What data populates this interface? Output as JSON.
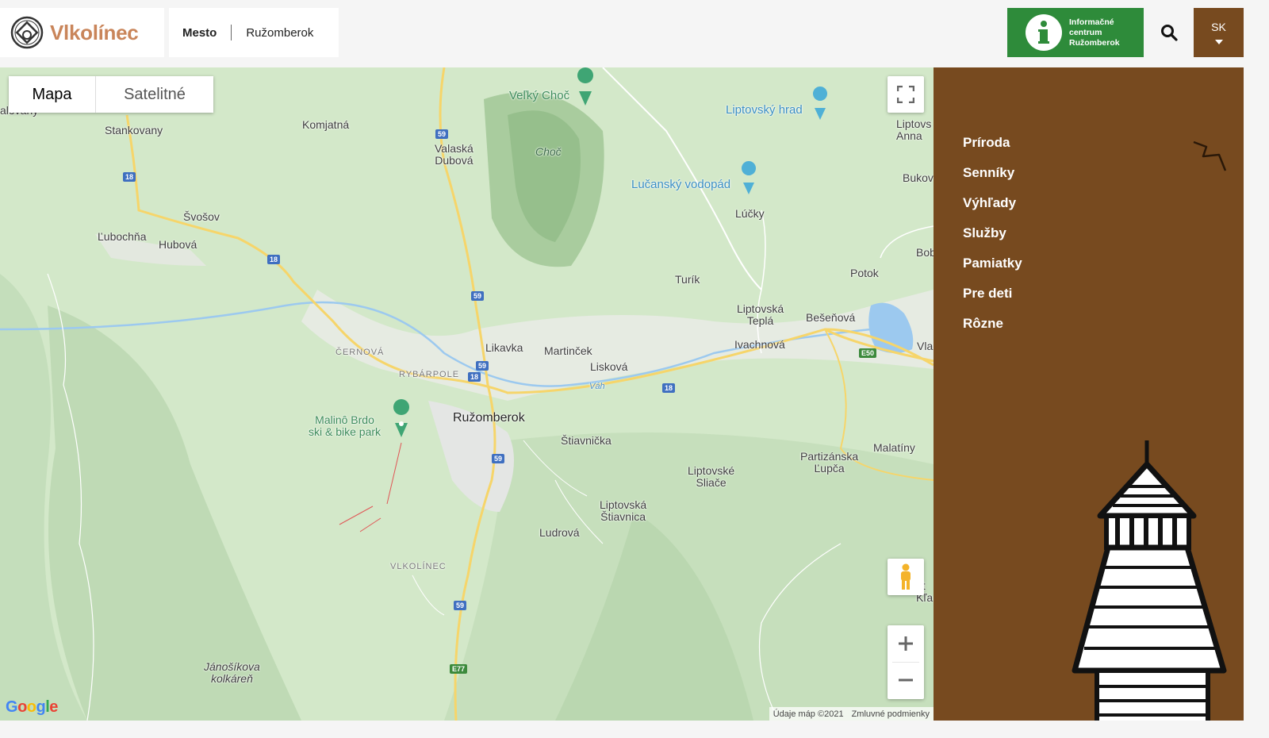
{
  "header": {
    "logo_text": "Vlkolínec",
    "breadcrumb": {
      "item1": "Mesto",
      "item2": "Ružomberok"
    },
    "info_button": "Informačné\ncentrum\nRužomberok",
    "search_icon": "search-icon",
    "language": "SK"
  },
  "map": {
    "type_buttons": {
      "map": "Mapa",
      "satellite": "Satelitné"
    },
    "labels": {
      "stankovany": "Stankovany",
      "komjatna": "Komjatná",
      "valaska_dubova": "Valaská\nDubová",
      "velky_choc": "Veľký Choč",
      "choc": "Choč",
      "liptovsky_hrad": "Liptovský hrad",
      "liptovska_anna": "Liptovs\nAnna",
      "bukov": "Bukov",
      "lucansky_vodopad": "Lučanský vodopád",
      "lucky": "Lúčky",
      "svosov": "Švošov",
      "lubochna": "Ľubochňa",
      "hubova": "Hubová",
      "bob": "Bob",
      "turik": "Turík",
      "potok": "Potok",
      "liptovska_tepla": "Liptovská\nTeplá",
      "besenova": "Bešeňová",
      "vla": "Vla",
      "cernova": "ČERNOVÁ",
      "likavka": "Likavka",
      "martincek": "Martinček",
      "ivachnova": "Ivachnová",
      "rybarpole": "RYBÁRPOLE",
      "liskova": "Lisková",
      "vah": "Váh",
      "malino_brdo": "Malinô Brdo\nski & bike park",
      "ruzomberok": "Ružomberok",
      "stiavnicka": "Štiavnička",
      "malatiny": "Malatíny",
      "partizanska_lupca": "Partizánska\nĽupča",
      "liptovske_sliace": "Liptovské\nSliače",
      "liptovska_stiavnica": "Liptovská\nŠtiavnica",
      "ludrova": "Ludrová",
      "vlkolinec": "VLKOLÍNEC",
      "kla": "ot\nKľa",
      "janosikova": "Jánošíkova\nkolkáreň",
      "alovany": "alovany"
    },
    "shields": {
      "s59a": "59",
      "s18a": "18",
      "s18b": "18",
      "s59b": "59",
      "s59c": "59",
      "s18c": "18",
      "s18d": "18",
      "se50": "E50",
      "s59d": "59",
      "s59e": "59",
      "se77": "E77"
    },
    "google": "Google",
    "attribution": {
      "data": "Údaje máp ©2021",
      "terms": "Zmluvné podmienky"
    }
  },
  "sidebar": {
    "menu": [
      "Príroda",
      "Senníky",
      "Výhľady",
      "Služby",
      "Pamiatky",
      "Pre deti",
      "Rôzne"
    ]
  },
  "colors": {
    "brown": "#774a1f",
    "green": "#2e8b3a",
    "logo": "#c9855a",
    "map_land": "#cfe5c4",
    "road_yellow": "#f6d56a",
    "water": "#9cc9ef"
  }
}
